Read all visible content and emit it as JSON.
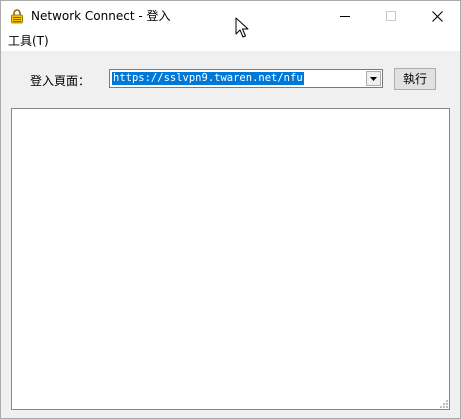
{
  "window": {
    "title": "Network Connect - 登入",
    "app_icon": "lock-icon"
  },
  "caption_buttons": {
    "minimize_icon": "minimize-icon",
    "maximize_icon": "maximize-icon",
    "close_icon": "close-icon"
  },
  "menubar": {
    "items": [
      {
        "label": "工具(T)"
      }
    ]
  },
  "login": {
    "label": "登入頁面：",
    "url_value": "https://sslvpn9.twaren.net/nfu",
    "url_selected": true,
    "run_label": "執行"
  },
  "colors": {
    "selection": "#0078d7",
    "window_bg": "#f0f0f0",
    "titlebar_bg": "#ffffff",
    "icon_yellow": "#f2c200"
  }
}
